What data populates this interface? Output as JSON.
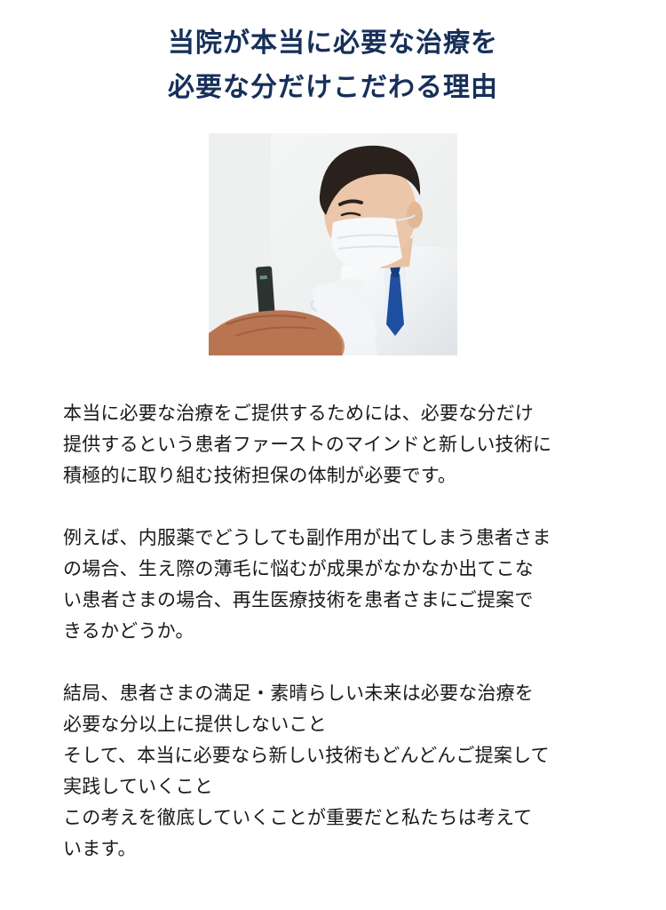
{
  "heading": {
    "line1": "当院が本当に必要な治療を",
    "line2": "必要な分だけこだわる理由"
  },
  "photo": {
    "subject": "doctor-examining-scalp"
  },
  "paragraphs": {
    "p1": {
      "l1": "本当に必要な治療をご提供するためには、必要な分だけ",
      "l2": "提供するという患者ファーストのマインドと新しい技術に",
      "l3": "積極的に取り組む技術担保の体制が必要です。"
    },
    "p2": {
      "l1": "例えば、内服薬でどうしても副作用が出てしまう患者さま",
      "l2": "の場合、生え際の薄毛に悩むが成果がなかなか出てこな",
      "l3": "い患者さまの場合、再生医療技術を患者さまにご提案で",
      "l4": "きるかどうか。"
    },
    "p3": {
      "l1": "結局、患者さまの満足・素晴らしい未来は必要な治療を",
      "l2": "必要な分以上に提供しないこと",
      "l3": "そして、本当に必要なら新しい技術もどんどんご提案して",
      "l4": "実践していくこと",
      "l5": "この考えを徹底していくことが重要だと私たちは考えて",
      "l6": "います。"
    }
  }
}
